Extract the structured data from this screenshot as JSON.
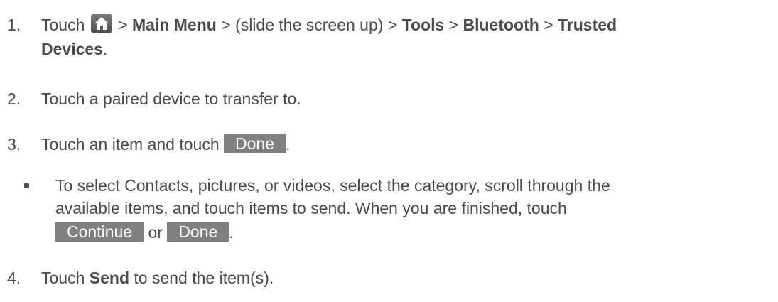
{
  "steps": [
    {
      "num": "1.",
      "touch": "Touch",
      "sep1": ">",
      "main_menu": "Main Menu",
      "sep2": ">",
      "slide": "(slide the screen up)",
      "sep3": ">",
      "tools": "Tools",
      "sep4": ">",
      "bluetooth": "Bluetooth",
      "sep5": ">",
      "trusted": "Trusted",
      "devices": "Devices",
      "end": "."
    },
    {
      "num": "2.",
      "text": "Touch a paired device to transfer to."
    },
    {
      "num": "3.",
      "text": "Touch an item and touch",
      "button": "Done",
      "end": "."
    },
    {
      "num": "4.",
      "touch": "Touch",
      "send": "Send",
      "rest": "to send the item(s)."
    }
  ],
  "sub_bullet": {
    "line1": "To select Contacts, pictures, or videos, select the category, scroll through the",
    "line2": "available items, and touch items to send. When you are finished, touch",
    "continue_button": "Continue",
    "or": "or",
    "done_button": "Done",
    "end": "."
  },
  "icons": {
    "home": "home-icon"
  }
}
